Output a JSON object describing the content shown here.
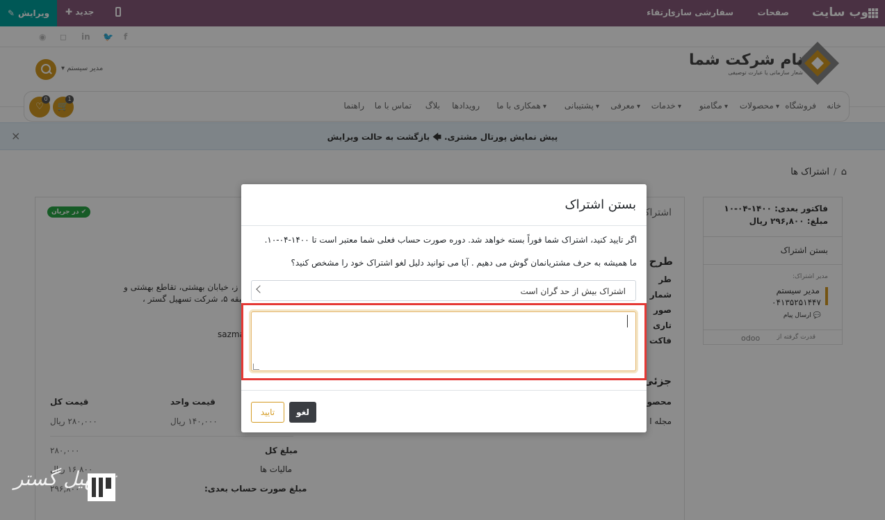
{
  "topbar": {
    "brand": "وب سایت",
    "menu": [
      "صفحات",
      "سفارشی سازی",
      "ارتقاء"
    ],
    "edit_label": "ویرایش",
    "new_label": "جدید"
  },
  "social_icons": [
    "facebook-icon",
    "twitter-icon",
    "linkedin-icon",
    "instagram-icon",
    "github-icon"
  ],
  "logo": {
    "title": "نام شرکت شما",
    "subtitle": "شعار سازمانی یا عبارت توصیفی"
  },
  "user_menu": "مدیر سیستم",
  "nav": [
    "خانه",
    "فروشگاه",
    "محصولات",
    "مگامنو",
    "خدمات",
    "معرفی",
    "پشتیبانی",
    "همکاری با ما",
    "رویدادها",
    "بلاگ",
    "تماس با ما",
    "راهنما"
  ],
  "cart_count": "1",
  "wishlist_count": "0",
  "banner": {
    "text": "پیش نمایش پورتال مشتری.",
    "link": "بازگشت به حالت ویرایش"
  },
  "breadcrumb": "اشتراک ها",
  "status_badge": "در جریان",
  "background": {
    "tab_label": "اشتراک",
    "plan_heading": "طرح",
    "labels": [
      "طر",
      "شمار",
      "صور",
      "تاری",
      "فاکت"
    ],
    "address_line1": "ز، خیابان بهشتی، تقاطع بهشتی و",
    "address_line2": "طبقه ۵، شرکت تسهیل گستر ،",
    "email_fragment": "sazma",
    "details_heading": "جزئی",
    "product_header": "محصو",
    "product_name": "مجله ا",
    "col_unit_price": "قیمت واحد",
    "col_total": "قیمت کل",
    "unit_price": "۱۴۰,۰۰۰ ریال",
    "line_total": "۲۸۰,۰۰۰ ریال",
    "sum_label": "مبلغ کل",
    "sum_value": "۲۸۰,۰۰۰",
    "tax_label": "مالیات ها",
    "tax_value": "۱۶,۸۰۰ ریال",
    "next_bill_label": "مبلغ صورت حساب بعدی:",
    "next_bill_value": "۲۹۶,۸۰۰"
  },
  "sidebar": {
    "next_invoice": "فاکتور بعدی: ۱۴۰۰-۰۴-۱۰",
    "amount": "مبلغ: ۲۹۶,۸۰۰ ریال",
    "close_link": "بستن اشتراک",
    "manager_label": "مدیر اشتراک:",
    "manager_name": "مدیر سیستم",
    "manager_phone": "۰۴۱۳۵۲۵۱۴۴۷",
    "send_message": "ارسال پیام",
    "powered_by": "قدرت گرفته از",
    "odoo": "odoo"
  },
  "modal": {
    "title": "بستن اشتراک",
    "message": "اگر تایید کنید، اشتراک شما فوراً بسته خواهد شد. دوره صورت حساب فعلی شما معتبر است تا ۱۴۰۰-۰۴-۱۰.",
    "question": "ما همیشه به حرف مشتریانمان گوش می دهیم . آیا می توانید دلیل لغو اشتراک خود را مشخص کنید؟",
    "reason_selected": "اشتراک بیش از حد گران است",
    "comment_value": "",
    "cancel_label": "لغو",
    "confirm_label": "تایید"
  },
  "watermark": "تسهیل گستر",
  "colors": {
    "topbar": "#875a7b",
    "edit_button": "#00a09d",
    "accent": "#d49a21",
    "highlight": "#e53935",
    "status": "#28a745"
  }
}
